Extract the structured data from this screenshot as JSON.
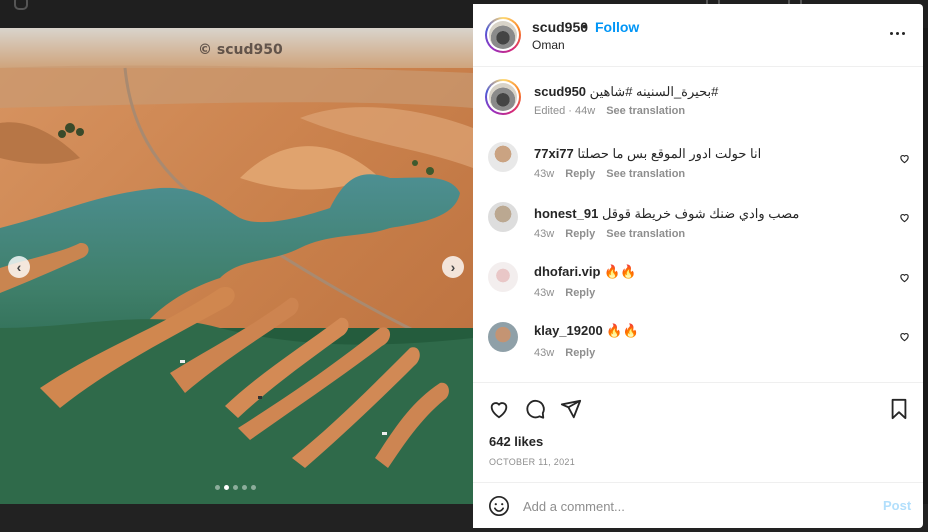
{
  "post": {
    "username": "scud950",
    "follow_label": "Follow",
    "separator": "•",
    "location": "Oman",
    "watermark": "© scud950",
    "image_count": 5,
    "image_index": 2,
    "caption": {
      "username": "scud950",
      "text": "بحيرة_السنينه #شاهين#",
      "age": "Edited · 44w",
      "translate_label": "See translation"
    },
    "comments": [
      {
        "username": "77xi77",
        "text": "انا حولت ادور الموقع بس ما حصلتا",
        "age": "43w",
        "reply_label": "Reply",
        "translate_label": "See translation"
      },
      {
        "username": "honest_91",
        "text": "مصب وادي ضنك شوف خريطة قوقل",
        "age": "43w",
        "reply_label": "Reply",
        "translate_label": "See translation"
      },
      {
        "username": "dhofari.vip",
        "text": "🔥🔥",
        "age": "43w",
        "reply_label": "Reply"
      },
      {
        "username": "klay_19200",
        "text": "🔥🔥",
        "age": "43w",
        "reply_label": "Reply"
      }
    ],
    "likes": "642 likes",
    "date": "OCTOBER 11, 2021"
  },
  "composer": {
    "placeholder": "Add a comment...",
    "post_label": "Post"
  },
  "icons": {
    "like": "heart-icon",
    "comment": "comment-icon",
    "share": "send-icon",
    "save": "bookmark-icon",
    "emoji": "emoji-icon",
    "more": "more-icon",
    "prev": "chevron-left-icon",
    "next": "chevron-right-icon"
  },
  "colors": {
    "accent": "#0095f6",
    "post_disabled": "#b2dffc",
    "muted": "#8e8e8e"
  }
}
